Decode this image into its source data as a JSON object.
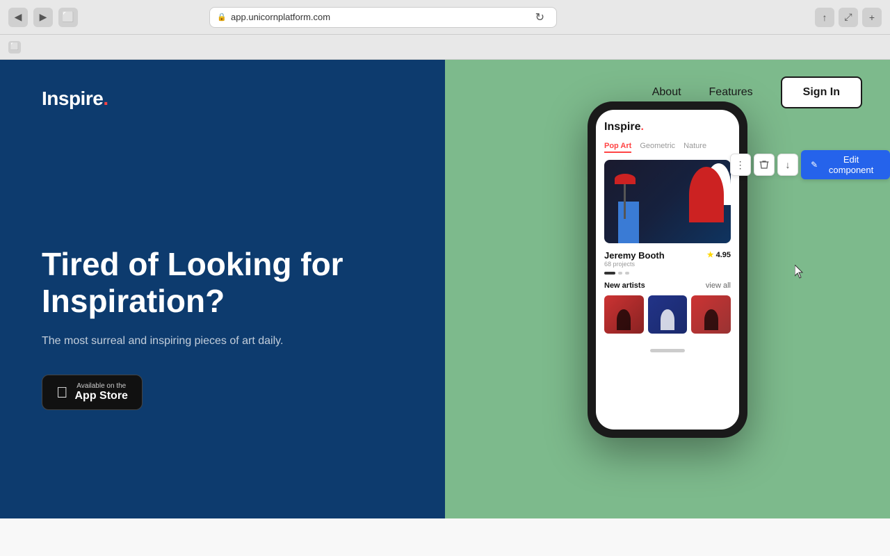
{
  "browser": {
    "url": "app.unicornplatform.com",
    "back_btn": "◀",
    "forward_btn": "▶",
    "tab_btn": "⬜",
    "reload": "↻",
    "share": "↑",
    "fullscreen": "⤢",
    "add_tab": "+"
  },
  "nav": {
    "about": "About",
    "features": "Features",
    "sign_in": "Sign In"
  },
  "logo": {
    "text": "Inspire",
    "dot": "."
  },
  "hero": {
    "heading": "Tired of Looking for Inspiration?",
    "subtext": "The most surreal and inspiring pieces of art daily.",
    "app_store_small": "Available on the",
    "app_store_large": "App Store"
  },
  "phone_app": {
    "logo": "Inspire",
    "tabs": [
      "Pop Art",
      "Geometric",
      "Nature"
    ],
    "artist_name": "Jeremy Booth",
    "artist_projects": "68 projects",
    "rating": "4.95",
    "section_title": "New artists",
    "view_all": "view all"
  },
  "toolbar": {
    "more_icon": "⋮",
    "delete_icon": "🗑",
    "down_icon": "↓",
    "edit_label": "Edit component",
    "edit_icon": "✎"
  }
}
